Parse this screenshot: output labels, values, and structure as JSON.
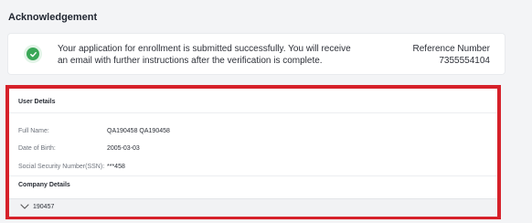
{
  "page": {
    "title": "Acknowledgement"
  },
  "confirmation": {
    "message": "Your application for enrollment is submitted successfully. You will receive an email with further instructions after the verification is complete.",
    "reference_label": "Reference Number",
    "reference_number": "7355554104",
    "icon": "check-circle-icon",
    "success_color": "#3aa757"
  },
  "user_details": {
    "heading": "User Details",
    "rows": [
      {
        "label": "Full Name:",
        "value": "QA190458 QA190458"
      },
      {
        "label": "Date of Birth:",
        "value": "2005-03-03"
      },
      {
        "label": "Social Security Number(SSN):",
        "value": "***458"
      }
    ]
  },
  "company_details": {
    "heading": "Company Details",
    "item": "190457",
    "icon": "chevron-down-icon"
  },
  "highlight_color": "#d6212a"
}
